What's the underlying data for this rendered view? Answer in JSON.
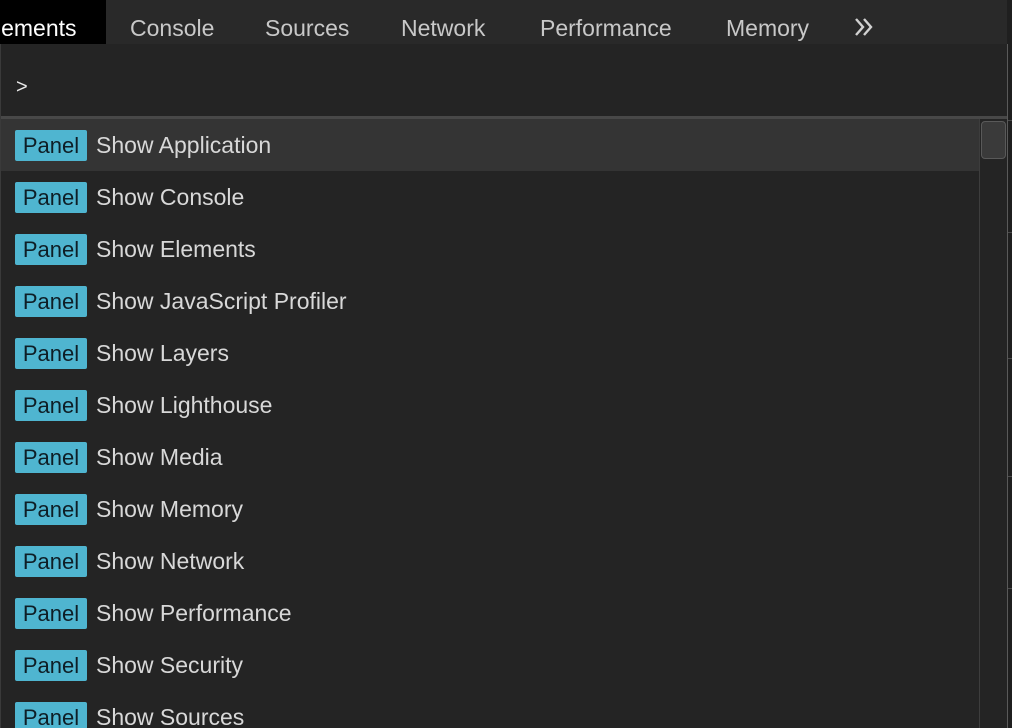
{
  "tabs": [
    {
      "label": "lements",
      "active": true
    },
    {
      "label": "Console",
      "active": false
    },
    {
      "label": "Sources",
      "active": false
    },
    {
      "label": "Network",
      "active": false
    },
    {
      "label": "Performance",
      "active": false
    },
    {
      "label": "Memory",
      "active": false
    }
  ],
  "more_tabs_icon": "double-chevron-right",
  "command_menu": {
    "prompt_prefix": ">",
    "input_value": "",
    "items": [
      {
        "badge": "Panel",
        "label": "Show Application",
        "selected": true
      },
      {
        "badge": "Panel",
        "label": "Show Console"
      },
      {
        "badge": "Panel",
        "label": "Show Elements"
      },
      {
        "badge": "Panel",
        "label": "Show JavaScript Profiler"
      },
      {
        "badge": "Panel",
        "label": "Show Layers"
      },
      {
        "badge": "Panel",
        "label": "Show Lighthouse"
      },
      {
        "badge": "Panel",
        "label": "Show Media"
      },
      {
        "badge": "Panel",
        "label": "Show Memory"
      },
      {
        "badge": "Panel",
        "label": "Show Network"
      },
      {
        "badge": "Panel",
        "label": "Show Performance"
      },
      {
        "badge": "Panel",
        "label": "Show Security"
      },
      {
        "badge": "Panel",
        "label": "Show Sources"
      }
    ]
  },
  "colors": {
    "badge_bg": "#4fb5d0",
    "selected_row": "#343434",
    "background": "#242424",
    "tabbar": "#292929"
  }
}
